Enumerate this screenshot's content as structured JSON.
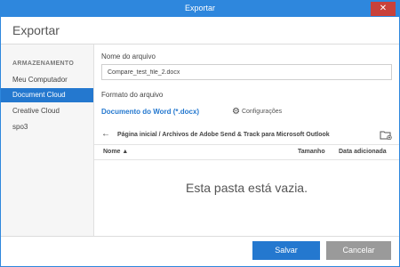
{
  "window": {
    "title": "Exportar",
    "close_glyph": "✕"
  },
  "header": {
    "title": "Exportar"
  },
  "sidebar": {
    "section_label": "ARMAZENAMENTO",
    "items": [
      {
        "label": "Meu Computador",
        "active": false
      },
      {
        "label": "Document Cloud",
        "active": true
      },
      {
        "label": "Creative Cloud",
        "active": false
      },
      {
        "label": "spo3",
        "active": false
      }
    ]
  },
  "form": {
    "filename_label": "Nome do arquivo",
    "filename_value": "Compare_test_file_2.docx",
    "format_label": "Formato do arquivo",
    "format_value": "Documento do Word (*.docx)",
    "settings_label": "Configurações",
    "settings_icon": "gear-icon"
  },
  "browser": {
    "back_icon": "arrow-left-icon",
    "back_glyph": "←",
    "breadcrumb": "Página inicial / Archivos de Adobe Send & Track para Microsoft Outlook",
    "new_folder_icon": "new-folder-icon",
    "columns": {
      "name": "Nome ▲",
      "size": "Tamanho",
      "date": "Data adicionada"
    },
    "empty_message": "Esta pasta está vazia."
  },
  "footer": {
    "save_label": "Salvar",
    "cancel_label": "Cancelar"
  },
  "colors": {
    "accent": "#2478cf",
    "title_bar": "#2e87dd",
    "close": "#c9413a",
    "cancel": "#9a9a9a"
  }
}
